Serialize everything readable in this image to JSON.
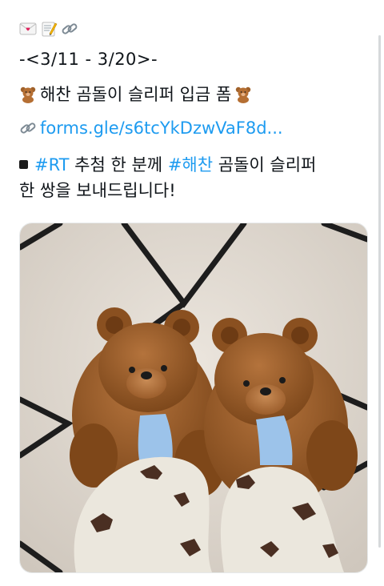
{
  "tweet": {
    "emojis": [
      "love-letter-icon",
      "memo-icon",
      "link-icon"
    ],
    "date_range": "-<3/11 - 3/20>-",
    "title": "해찬 곰돌이 슬리퍼 입금 폼",
    "link_text": "forms.gle/s6tcYkDzwVaF8d...",
    "body_hashtag_1": "#RT",
    "body_text_1": " 추첨 한 분께 ",
    "body_hashtag_2": "#해찬",
    "body_text_2": " 곰돌이 슬리퍼",
    "body_line_2": "한 쌍을 보내드립니다!"
  },
  "colors": {
    "link": "#1d9bf0",
    "text": "#0f1419",
    "scrollbar": "#d6d9db"
  },
  "photo": {
    "subject": "teddy-bear-slippers-photo"
  }
}
